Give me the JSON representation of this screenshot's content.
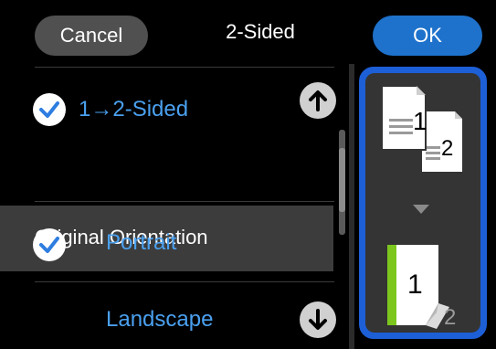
{
  "header": {
    "cancel_label": "Cancel",
    "title": "2-Sided",
    "ok_label": "OK"
  },
  "list": {
    "option_two_sided": "1→2-Sided",
    "section_orientation": "Original Orientation",
    "option_portrait": "Portrait",
    "option_landscape": "Landscape"
  },
  "preview": {
    "page_front_number": "1",
    "page_back_number": "2",
    "result_front_number": "1",
    "result_back_number": "2"
  },
  "colors": {
    "accent_blue": "#1e72cc",
    "selected_text": "#4aa0ef",
    "frame_highlight": "#1d5fd6",
    "binding_green": "#7cc61e"
  },
  "icons": [
    "check-circle-icon",
    "scroll-up-icon",
    "scroll-down-icon",
    "arrow-down-icon"
  ]
}
